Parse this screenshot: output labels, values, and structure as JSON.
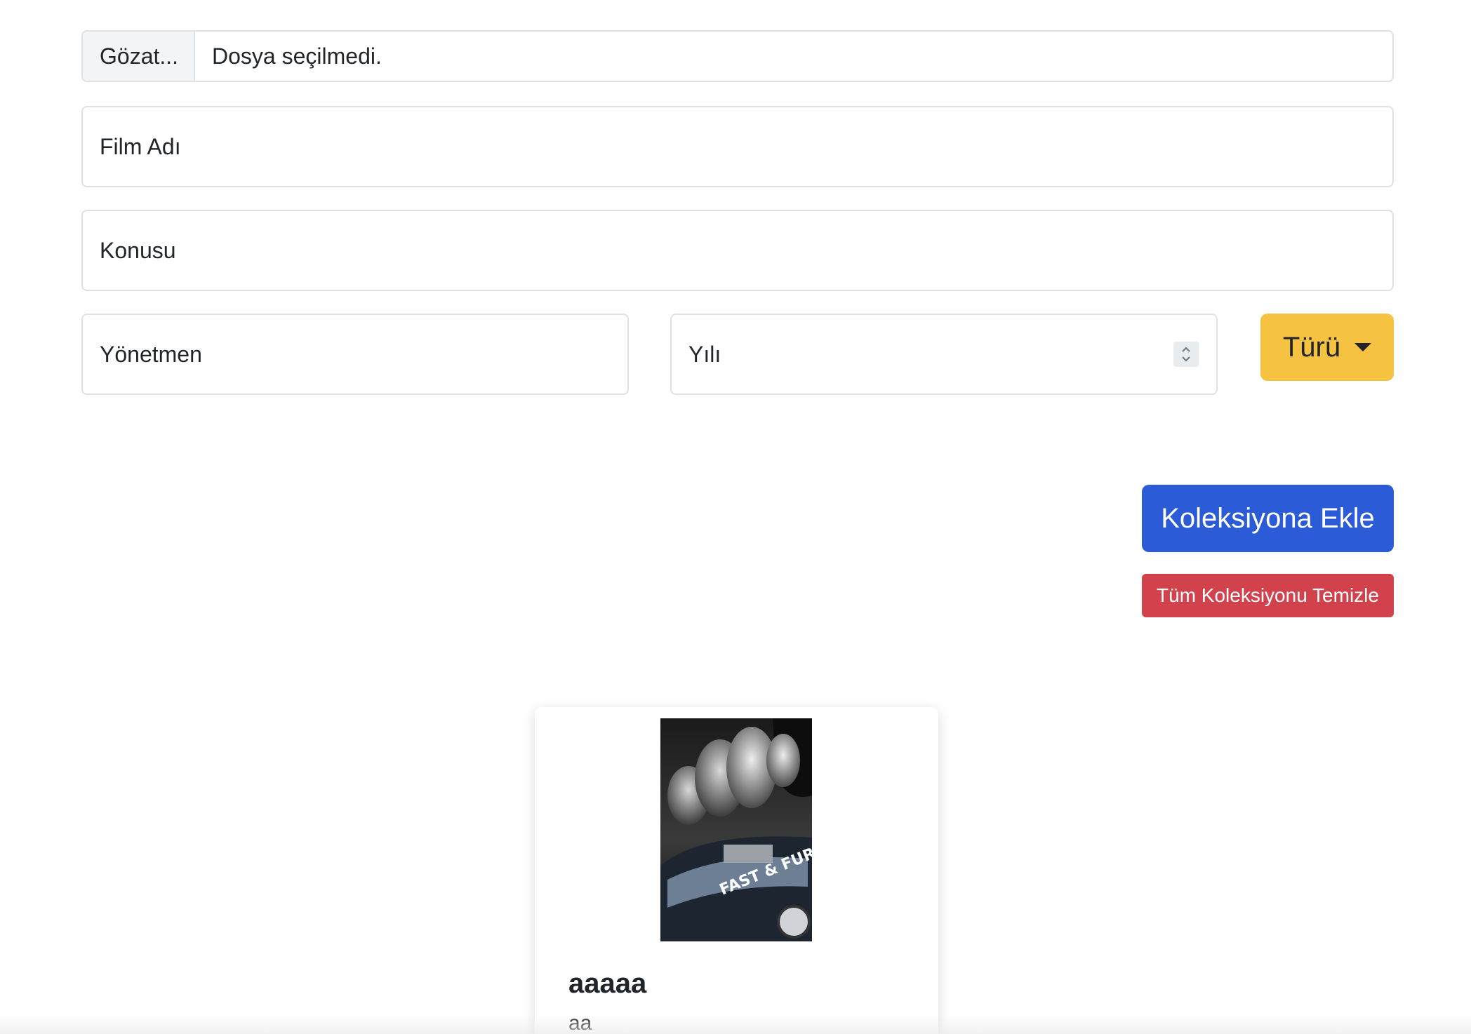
{
  "file_input": {
    "button_label": "Gözat...",
    "status_text": "Dosya seçilmedi."
  },
  "form": {
    "film_adi_placeholder": "Film Adı",
    "konusu_placeholder": "Konusu",
    "yonetmen_placeholder": "Yönetmen",
    "yili_placeholder": "Yılı",
    "turu_label": "Türü"
  },
  "actions": {
    "add_label": "Koleksiyona Ekle",
    "clear_label": "Tüm Koleksiyonu Temizle"
  },
  "collection": [
    {
      "title": "aaaaa",
      "text": "aa",
      "poster_alt": "FAST & FURIOUS"
    }
  ],
  "colors": {
    "primary": "#2b5bd7",
    "warning": "#f5c242",
    "danger": "#d1424c"
  }
}
